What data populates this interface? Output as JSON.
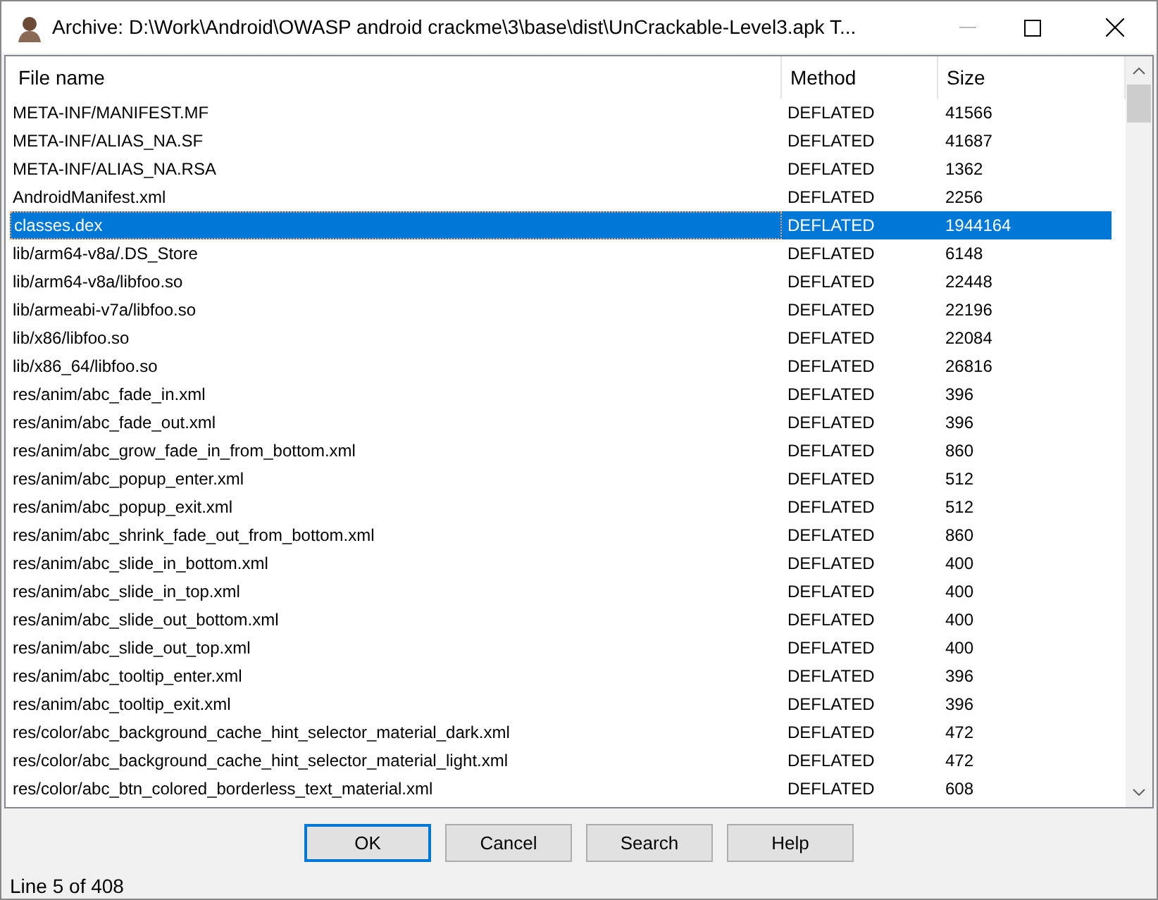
{
  "window": {
    "title": "Archive: D:\\Work\\Android\\OWASP android crackme\\3\\base\\dist\\UnCrackable-Level3.apk T..."
  },
  "table": {
    "columns": [
      "File name",
      "Method",
      "Size"
    ],
    "rows": [
      {
        "name": "META-INF/MANIFEST.MF",
        "method": "DEFLATED",
        "size": "41566",
        "selected": false
      },
      {
        "name": "META-INF/ALIAS_NA.SF",
        "method": "DEFLATED",
        "size": "41687",
        "selected": false
      },
      {
        "name": "META-INF/ALIAS_NA.RSA",
        "method": "DEFLATED",
        "size": "1362",
        "selected": false
      },
      {
        "name": "AndroidManifest.xml",
        "method": "DEFLATED",
        "size": "2256",
        "selected": false
      },
      {
        "name": "classes.dex",
        "method": "DEFLATED",
        "size": "1944164",
        "selected": true
      },
      {
        "name": "lib/arm64-v8a/.DS_Store",
        "method": "DEFLATED",
        "size": "6148",
        "selected": false
      },
      {
        "name": "lib/arm64-v8a/libfoo.so",
        "method": "DEFLATED",
        "size": "22448",
        "selected": false
      },
      {
        "name": "lib/armeabi-v7a/libfoo.so",
        "method": "DEFLATED",
        "size": "22196",
        "selected": false
      },
      {
        "name": "lib/x86/libfoo.so",
        "method": "DEFLATED",
        "size": "22084",
        "selected": false
      },
      {
        "name": "lib/x86_64/libfoo.so",
        "method": "DEFLATED",
        "size": "26816",
        "selected": false
      },
      {
        "name": "res/anim/abc_fade_in.xml",
        "method": "DEFLATED",
        "size": "396",
        "selected": false
      },
      {
        "name": "res/anim/abc_fade_out.xml",
        "method": "DEFLATED",
        "size": "396",
        "selected": false
      },
      {
        "name": "res/anim/abc_grow_fade_in_from_bottom.xml",
        "method": "DEFLATED",
        "size": "860",
        "selected": false
      },
      {
        "name": "res/anim/abc_popup_enter.xml",
        "method": "DEFLATED",
        "size": "512",
        "selected": false
      },
      {
        "name": "res/anim/abc_popup_exit.xml",
        "method": "DEFLATED",
        "size": "512",
        "selected": false
      },
      {
        "name": "res/anim/abc_shrink_fade_out_from_bottom.xml",
        "method": "DEFLATED",
        "size": "860",
        "selected": false
      },
      {
        "name": "res/anim/abc_slide_in_bottom.xml",
        "method": "DEFLATED",
        "size": "400",
        "selected": false
      },
      {
        "name": "res/anim/abc_slide_in_top.xml",
        "method": "DEFLATED",
        "size": "400",
        "selected": false
      },
      {
        "name": "res/anim/abc_slide_out_bottom.xml",
        "method": "DEFLATED",
        "size": "400",
        "selected": false
      },
      {
        "name": "res/anim/abc_slide_out_top.xml",
        "method": "DEFLATED",
        "size": "400",
        "selected": false
      },
      {
        "name": "res/anim/abc_tooltip_enter.xml",
        "method": "DEFLATED",
        "size": "396",
        "selected": false
      },
      {
        "name": "res/anim/abc_tooltip_exit.xml",
        "method": "DEFLATED",
        "size": "396",
        "selected": false
      },
      {
        "name": "res/color/abc_background_cache_hint_selector_material_dark.xml",
        "method": "DEFLATED",
        "size": "472",
        "selected": false
      },
      {
        "name": "res/color/abc_background_cache_hint_selector_material_light.xml",
        "method": "DEFLATED",
        "size": "472",
        "selected": false
      },
      {
        "name": "res/color/abc_btn_colored_borderless_text_material.xml",
        "method": "DEFLATED",
        "size": "608",
        "selected": false
      }
    ]
  },
  "buttons": [
    {
      "label": "OK",
      "selected": true
    },
    {
      "label": "Cancel",
      "selected": false
    },
    {
      "label": "Search",
      "selected": false
    },
    {
      "label": "Help",
      "selected": false
    }
  ],
  "status_bar": "Line 5 of 408"
}
